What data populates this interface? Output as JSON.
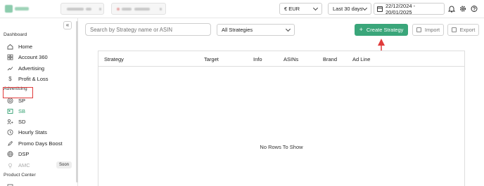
{
  "topbar": {
    "currency": {
      "value": "€ EUR"
    },
    "period": {
      "value": "Last 30 days"
    },
    "date_range": {
      "value": "22/12/2024 - 20/01/2025"
    },
    "icons": [
      "bell-icon",
      "gear-icon",
      "help-icon"
    ]
  },
  "sidebar": {
    "sections": [
      {
        "title": "Dashboard",
        "items": [
          {
            "label": "Home",
            "icon": "home-icon"
          },
          {
            "label": "Account 360",
            "icon": "grid-icon"
          },
          {
            "label": "Advertising",
            "icon": "trend-icon"
          },
          {
            "label": "Profit & Loss",
            "icon": "dollar-icon"
          }
        ]
      },
      {
        "title": "Advertising",
        "items": [
          {
            "label": "SP",
            "icon": "target-icon"
          },
          {
            "label": "SB",
            "icon": "sb-icon",
            "active": true
          },
          {
            "label": "SD",
            "icon": "sd-icon"
          },
          {
            "label": "Hourly Stats",
            "icon": "clock-icon"
          },
          {
            "label": "Promo Days Boost",
            "icon": "rocket-icon"
          },
          {
            "label": "DSP",
            "icon": "globe-icon"
          },
          {
            "label": "AMC",
            "icon": "bulb-icon",
            "badge": "Soon",
            "disabled": true
          }
        ]
      },
      {
        "title": "Product Center",
        "items": []
      }
    ]
  },
  "toolbar": {
    "search_placeholder": "Search by Strategy name or ASIN",
    "strategy_filter": "All Strategies",
    "create_label": "Create Strategy",
    "import_label": "Import",
    "export_label": "Export"
  },
  "table": {
    "columns": [
      "Strategy",
      "Target",
      "Info",
      "ASINs",
      "Brand",
      "Ad Line"
    ],
    "empty_message": "No Rows To Show"
  },
  "colors": {
    "accent": "#3aa67a",
    "annotation": "#e03b3b"
  }
}
